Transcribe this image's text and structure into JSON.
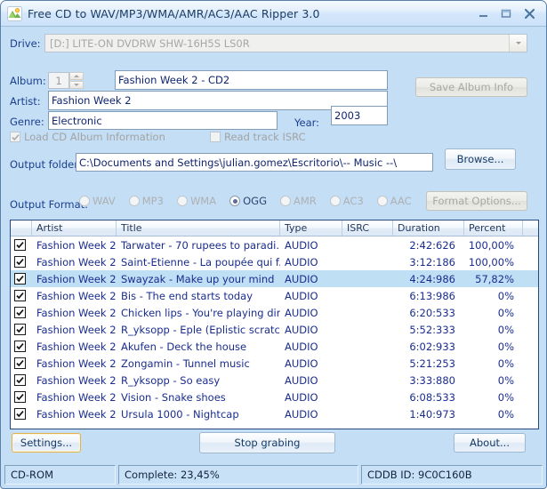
{
  "window": {
    "title": "Free CD to WAV/MP3/WMA/AMR/AC3/AAC Ripper 3.0",
    "icon": "cd-ripper-icon",
    "minimize": "minimize-icon",
    "maximize": "maximize-icon",
    "close": "close-icon"
  },
  "drive": {
    "label": "Drive:",
    "value": "[D:]  LITE-ON  DVDRW SHW-16H5S  LS0R"
  },
  "album": {
    "label": "Album:",
    "number": "1",
    "title": "Fashion Week 2 - CD2",
    "artist_label": "Artist:",
    "artist": "Fashion Week 2",
    "genre_label": "Genre:",
    "genre": "Electronic",
    "year_label": "Year:",
    "year": "2003",
    "save_button": "Save Album Info"
  },
  "options": {
    "load_cd_album_info": "Load CD Album Information",
    "load_cd_album_info_checked": true,
    "read_track_isrc": "Read track ISRC",
    "read_track_isrc_checked": false
  },
  "output": {
    "folder_label": "Output folder:",
    "folder": "C:\\Documents and Settings\\julian.gomez\\Escritorio\\-- Music --\\",
    "browse_button": "Browse...",
    "format_label": "Output Format:",
    "formats": [
      "WAV",
      "MP3",
      "WMA",
      "OGG",
      "AMR",
      "AC3",
      "AAC"
    ],
    "selected_format": "OGG",
    "format_options_button": "Format Options..."
  },
  "tracklist": {
    "columns": [
      "",
      "Artist",
      "Title",
      "Type",
      "ISRC",
      "Duration",
      "Percent"
    ],
    "rows": [
      {
        "checked": true,
        "artist": "Fashion Week 2",
        "title": "Tarwater - 70 rupees to paradi...",
        "type": "AUDIO",
        "isrc": "",
        "duration": "2:42:626",
        "percent": "100,00%",
        "selected": false
      },
      {
        "checked": true,
        "artist": "Fashion Week 2",
        "title": "Saint-Etienne - La poupée qui f...",
        "type": "AUDIO",
        "isrc": "",
        "duration": "3:12:186",
        "percent": "100,00%",
        "selected": false
      },
      {
        "checked": true,
        "artist": "Fashion Week 2",
        "title": "Swayzak - Make up your mind",
        "type": "AUDIO",
        "isrc": "",
        "duration": "4:24:986",
        "percent": "57,82%",
        "selected": true
      },
      {
        "checked": true,
        "artist": "Fashion Week 2",
        "title": "Bis - The end starts today",
        "type": "AUDIO",
        "isrc": "",
        "duration": "6:13:986",
        "percent": "0%",
        "selected": false
      },
      {
        "checked": true,
        "artist": "Fashion Week 2",
        "title": "Chicken lips - You're playing dirty",
        "type": "AUDIO",
        "isrc": "",
        "duration": "6:20:533",
        "percent": "0%",
        "selected": false
      },
      {
        "checked": true,
        "artist": "Fashion Week 2",
        "title": "R_yksopp - Eple (Eplistic scratc...",
        "type": "AUDIO",
        "isrc": "",
        "duration": "5:52:333",
        "percent": "0%",
        "selected": false
      },
      {
        "checked": true,
        "artist": "Fashion Week 2",
        "title": "Akufen - Deck the house",
        "type": "AUDIO",
        "isrc": "",
        "duration": "6:02:933",
        "percent": "0%",
        "selected": false
      },
      {
        "checked": true,
        "artist": "Fashion Week 2",
        "title": "Zongamin - Tunnel music",
        "type": "AUDIO",
        "isrc": "",
        "duration": "5:21:253",
        "percent": "0%",
        "selected": false
      },
      {
        "checked": true,
        "artist": "Fashion Week 2",
        "title": "R_yksopp - So easy",
        "type": "AUDIO",
        "isrc": "",
        "duration": "3:33:880",
        "percent": "0%",
        "selected": false
      },
      {
        "checked": true,
        "artist": "Fashion Week 2",
        "title": "Vision - Snake shoes",
        "type": "AUDIO",
        "isrc": "",
        "duration": "6:08:533",
        "percent": "0%",
        "selected": false
      },
      {
        "checked": true,
        "artist": "Fashion Week 2",
        "title": "Ursula 1000 - Nightcap",
        "type": "AUDIO",
        "isrc": "",
        "duration": "1:40:973",
        "percent": "0%",
        "selected": false
      }
    ]
  },
  "actions": {
    "settings": "Settings...",
    "stop_grabbing": "Stop grabing",
    "about": "About..."
  },
  "status": {
    "device": "CD-ROM",
    "complete": "Complete: 23,45%",
    "cddb": "CDDB ID: 9C0C160B"
  },
  "colors": {
    "window_bg": "#c3def5",
    "accent_text": "#1b3f8f",
    "selection": "#bfdff5",
    "list_text": "#1a2d8f"
  }
}
